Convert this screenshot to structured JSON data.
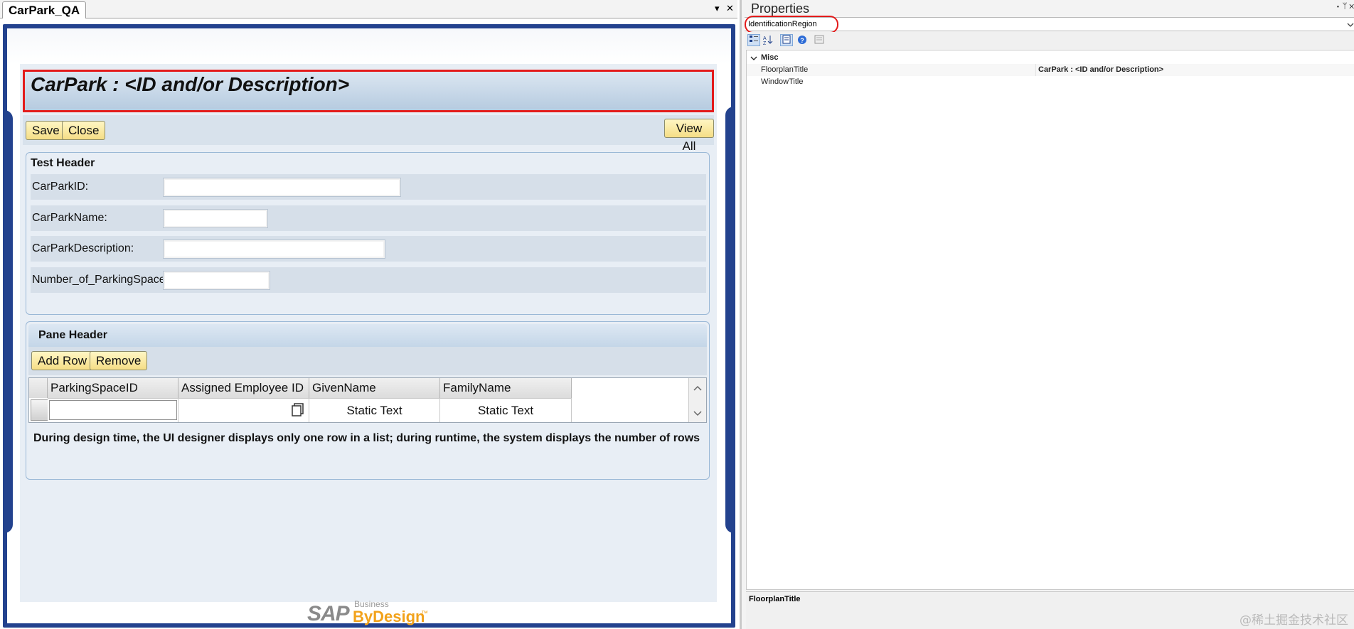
{
  "designer": {
    "tab_title": "CarPark_QA",
    "tab_menu_icon": "▾",
    "tab_close_icon": "✕"
  },
  "floorplan": {
    "title": "CarPark : <ID and/or Description>"
  },
  "toolbar": {
    "save_label": "Save",
    "close_label": "Close",
    "view_all_label": "View All"
  },
  "header_section": {
    "title": "Test Header",
    "fields": [
      {
        "label": "CarParkID:",
        "value": ""
      },
      {
        "label": "CarParkName:",
        "value": ""
      },
      {
        "label": "CarParkDescription:",
        "value": ""
      },
      {
        "label": "Number_of_ParkingSpaces:",
        "value": ""
      }
    ]
  },
  "pane": {
    "title": "Pane Header",
    "add_row_label": "Add Row",
    "remove_label": "Remove",
    "columns": [
      "ParkingSpaceID",
      "Assigned Employee ID",
      "GivenName",
      "FamilyName"
    ],
    "row": {
      "parking_space_id": "",
      "assigned_employee_id": "",
      "given_name": "Static Text",
      "family_name": "Static Text"
    },
    "hint": "During design time, the UI designer displays only one row in a list; during runtime, the system displays the number of rows"
  },
  "logo": {
    "brand": "SAP",
    "line1": "Business",
    "line2": "ByDesign",
    "tm": "™"
  },
  "properties": {
    "title": "Properties",
    "pin_icon": "▾ ᛘ ✕",
    "selected_object": "IdentificationRegion",
    "category": "Misc",
    "rows": [
      {
        "name": "FloorplanTitle",
        "value": "CarPark : <ID and/or Description>"
      },
      {
        "name": "WindowTitle",
        "value": ""
      }
    ],
    "description_title": "FloorplanTitle"
  },
  "watermark": "@稀土掘金技术社区",
  "colors": {
    "frame_blue": "#23428e",
    "highlight_red": "#e31b1b",
    "button_yellow": "#f5de86"
  }
}
